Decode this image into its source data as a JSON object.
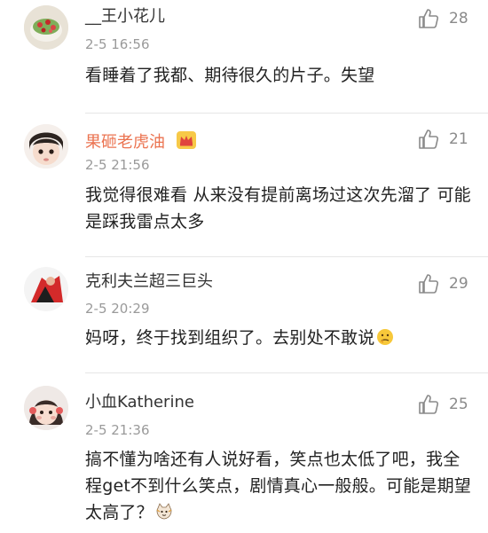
{
  "comments": [
    {
      "user": "__王小花儿",
      "time": "2-5 16:56",
      "text": "看睡着了我都、期待很久的片子。失望",
      "likes": "28",
      "avatar_icon": "cake-avatar",
      "vip": false
    },
    {
      "user": "果砸老虎油",
      "time": "2-5 21:56",
      "text": "我觉得很难看 从来没有提前离场过这次先溜了 可能是踩我雷点太多",
      "likes": "21",
      "avatar_icon": "child-avatar",
      "vip": true,
      "badge_icon": "crown-icon"
    },
    {
      "user": "克利夫兰超三巨头",
      "time": "2-5 20:29",
      "text": "妈呀，终于找到组织了。去别处不敢说",
      "likes": "29",
      "avatar_icon": "red-figure-avatar",
      "vip": false,
      "trailing_emoji": "thinking-emoji"
    },
    {
      "user": "小血Katherine",
      "time": "2-5 21:36",
      "text": "搞不懂为啥还有人说好看，笑点也太低了吧，我全程get不到什么笑点，剧情真心一般般。可能是期望太高了？",
      "likes": "25",
      "avatar_icon": "girl-avatar",
      "vip": false,
      "trailing_emoji": "cat-emoji"
    }
  ],
  "colors": {
    "vip_name": "#eb7350",
    "name": "#333333",
    "time": "#9a9a9a",
    "text": "#222222",
    "like": "#8a8a8a"
  }
}
